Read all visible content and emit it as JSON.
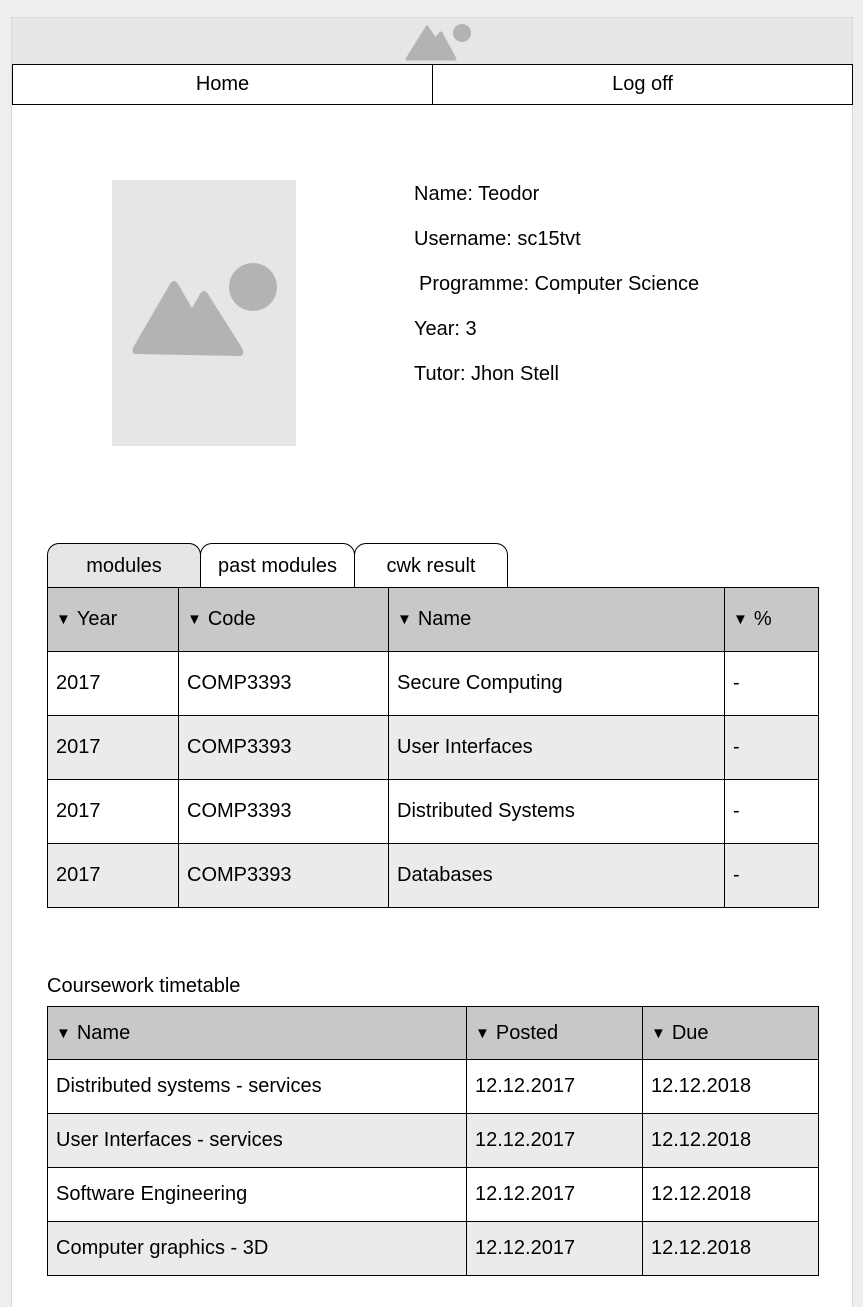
{
  "nav": {
    "items": [
      "Home",
      "Log off"
    ]
  },
  "profile": {
    "name": "Name: Teodor",
    "username": "Username: sc15tvt",
    "programme": "Programme: Computer Science",
    "year": "Year: 3",
    "tutor": "Tutor: Jhon Stell"
  },
  "tabs": [
    "modules",
    "past modules",
    "cwk result"
  ],
  "modules": {
    "headers": [
      "Year",
      "Code",
      "Name",
      "%"
    ],
    "sortable": [
      true,
      true,
      true,
      true
    ],
    "rows": [
      [
        "2017",
        "COMP3393",
        "Secure Computing",
        "-"
      ],
      [
        "2017",
        "COMP3393",
        "User Interfaces",
        "-"
      ],
      [
        "2017",
        "COMP3393",
        "Distributed Systems",
        "-"
      ],
      [
        "2017",
        "COMP3393",
        "Databases",
        "-"
      ]
    ]
  },
  "coursework": {
    "title": "Coursework timetable",
    "headers": [
      "Name",
      "Posted",
      "Due"
    ],
    "rows": [
      [
        "Distributed systems - services",
        "12.12.2017",
        "12.12.2018"
      ],
      [
        "User Interfaces - services",
        "12.12.2017",
        "12.12.2018"
      ],
      [
        "Software Engineering",
        "12.12.2017",
        "12.12.2018"
      ],
      [
        "Computer graphics - 3D",
        "12.12.2017",
        "12.12.2018"
      ]
    ]
  },
  "icons": {
    "banner": "image-placeholder-icon",
    "avatar": "image-placeholder-icon",
    "sort": "sort-down-icon"
  },
  "colors": {
    "header_bg": "#c8c8c8",
    "alt_row_bg": "#ebebeb",
    "placeholder_bg": "#e6e6e6",
    "placeholder_fg": "#b3b3b3"
  }
}
